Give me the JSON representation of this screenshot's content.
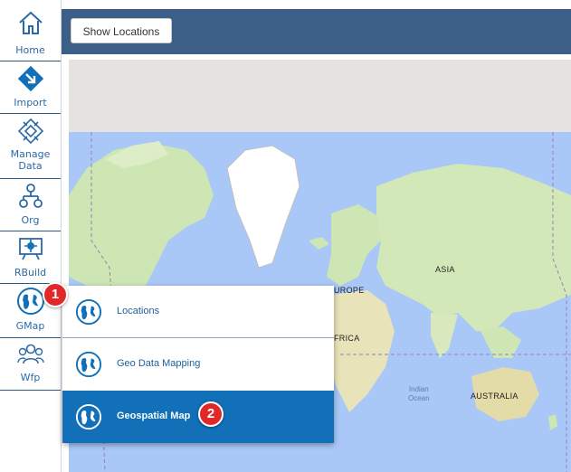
{
  "sidebar": {
    "items": [
      {
        "label": "Home",
        "icon": "home-icon"
      },
      {
        "label": "Import",
        "icon": "import-icon"
      },
      {
        "label": "Manage Data",
        "icon": "manage-data-icon"
      },
      {
        "label": "Org",
        "icon": "org-icon"
      },
      {
        "label": "RBuild",
        "icon": "rbuild-icon"
      },
      {
        "label": "GMap",
        "icon": "globe-icon"
      },
      {
        "label": "Wfp",
        "icon": "people-icon"
      }
    ]
  },
  "toolbar": {
    "show_locations_label": "Show Locations"
  },
  "menu": {
    "items": [
      {
        "label": "Locations",
        "icon": "globe-icon"
      },
      {
        "label": "Geo Data Mapping",
        "icon": "globe-icon"
      },
      {
        "label": "Geospatial Map",
        "icon": "globe-icon",
        "active": true
      }
    ]
  },
  "annotations": {
    "badge1": "1",
    "badge2": "2"
  },
  "map": {
    "labels": {
      "europe": "UROPE",
      "asia": "ASIA",
      "africa": "FRICA",
      "australia": "AUSTRALIA",
      "indian_ocean_1": "Indian",
      "indian_ocean_2": "Ocean"
    }
  },
  "colors": {
    "accent": "#1170b8",
    "topbar": "#3b5f86",
    "sidebar_text": "#2b6aa6",
    "badge": "#e02828",
    "ocean": "#a9c8f8",
    "land": "#cde6b4"
  }
}
